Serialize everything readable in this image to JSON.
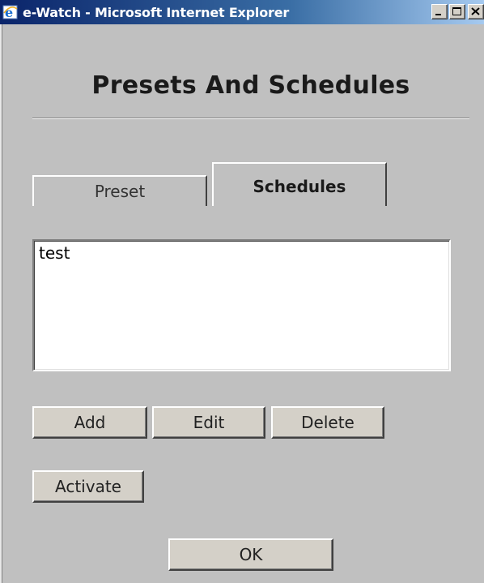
{
  "window": {
    "title": "e-Watch - Microsoft Internet Explorer",
    "app_icon": "internet-explorer-icon",
    "controls": [
      "minimize",
      "maximize",
      "close"
    ]
  },
  "dialog": {
    "heading": "Presets And Schedules",
    "tabs": [
      {
        "label": "Preset",
        "selected": false
      },
      {
        "label": "Schedules",
        "selected": true
      }
    ],
    "list": {
      "items": [
        "test"
      ]
    },
    "buttons": {
      "add": "Add",
      "edit": "Edit",
      "delete": "Delete",
      "activate": "Activate",
      "ok": "OK"
    }
  },
  "colors": {
    "background": "#c0c0c0",
    "titlebar_start": "#0a246a",
    "titlebar_end": "#a6caf0"
  }
}
